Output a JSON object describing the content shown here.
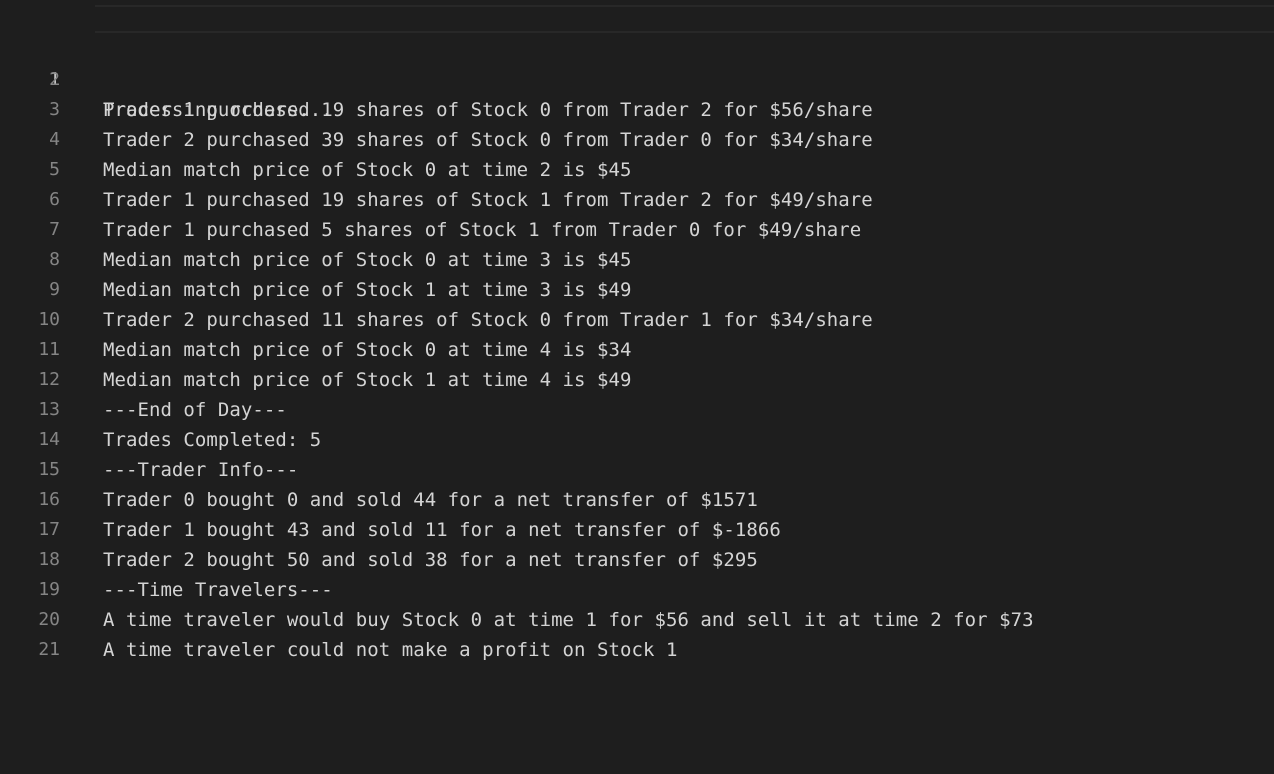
{
  "editor": {
    "lines": [
      {
        "num": "1",
        "text": "Processing orders..."
      },
      {
        "num": "2",
        "text": "Trader 1 purchased 19 shares of Stock 0 from Trader 2 for $56/share"
      },
      {
        "num": "3",
        "text": "Trader 2 purchased 39 shares of Stock 0 from Trader 0 for $34/share"
      },
      {
        "num": "4",
        "text": "Median match price of Stock 0 at time 2 is $45"
      },
      {
        "num": "5",
        "text": "Trader 1 purchased 19 shares of Stock 1 from Trader 2 for $49/share"
      },
      {
        "num": "6",
        "text": "Trader 1 purchased 5 shares of Stock 1 from Trader 0 for $49/share"
      },
      {
        "num": "7",
        "text": "Median match price of Stock 0 at time 3 is $45"
      },
      {
        "num": "8",
        "text": "Median match price of Stock 1 at time 3 is $49"
      },
      {
        "num": "9",
        "text": "Trader 2 purchased 11 shares of Stock 0 from Trader 1 for $34/share"
      },
      {
        "num": "10",
        "text": "Median match price of Stock 0 at time 4 is $34"
      },
      {
        "num": "11",
        "text": "Median match price of Stock 1 at time 4 is $49"
      },
      {
        "num": "12",
        "text": "---End of Day---"
      },
      {
        "num": "13",
        "text": "Trades Completed: 5"
      },
      {
        "num": "14",
        "text": "---Trader Info---"
      },
      {
        "num": "15",
        "text": "Trader 0 bought 0 and sold 44 for a net transfer of $1571"
      },
      {
        "num": "16",
        "text": "Trader 1 bought 43 and sold 11 for a net transfer of $-1866"
      },
      {
        "num": "17",
        "text": "Trader 2 bought 50 and sold 38 for a net transfer of $295"
      },
      {
        "num": "18",
        "text": "---Time Travelers---"
      },
      {
        "num": "19",
        "text": "A time traveler would buy Stock 0 at time 1 for $56 and sell it at time 2 for $73"
      },
      {
        "num": "20",
        "text": "A time traveler could not make a profit on Stock 1"
      },
      {
        "num": "21",
        "text": ""
      }
    ]
  }
}
